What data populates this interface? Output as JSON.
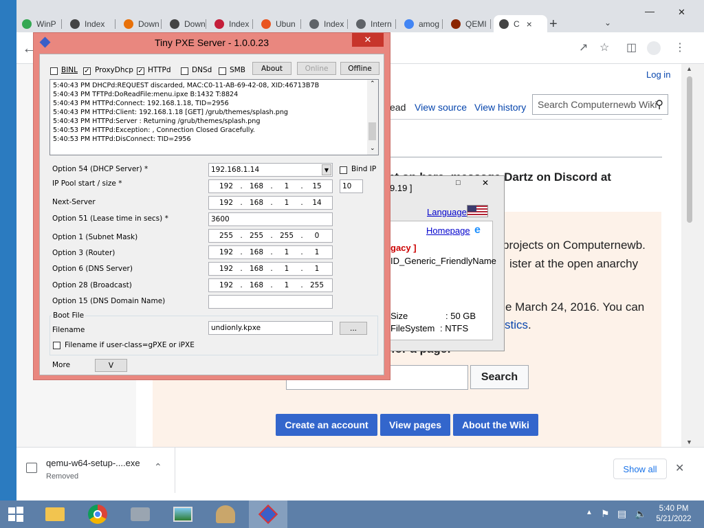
{
  "browser": {
    "tabs": [
      {
        "label": "WinP",
        "icon": "google-drive-icon",
        "color": "#34a853"
      },
      {
        "label": "Index",
        "icon": "archive-icon",
        "color": "#444444"
      },
      {
        "label": "Down",
        "icon": "diamond-icon",
        "color": "#e8710a"
      },
      {
        "label": "Down",
        "icon": "download-icon",
        "color": "#444444"
      },
      {
        "label": "Index",
        "icon": "arch-icon",
        "color": "#c41e3a"
      },
      {
        "label": "Ubun",
        "icon": "ubuntu-icon",
        "color": "#e95420"
      },
      {
        "label": "Index",
        "icon": "globe-icon",
        "color": "#5f6368"
      },
      {
        "label": "Intern",
        "icon": "globe-icon",
        "color": "#5f6368"
      },
      {
        "label": "amog",
        "icon": "google-icon",
        "color": "#4285f4"
      },
      {
        "label": "QEMI",
        "icon": "qemu-icon",
        "color": "#8b2500"
      },
      {
        "label": "C",
        "icon": "archive-icon",
        "color": "#444444"
      }
    ],
    "wiki": {
      "login": "Log in",
      "read_partial": "ead",
      "view_source": "View source",
      "view_history": "View history",
      "search_placeholder": "Search Computernewb Wiki",
      "notice": "nt on here, message Dartz on Discord at",
      "line1": "projects on Computernewb.",
      "line2": "ister at the open anarchy",
      "line3": "e March 24, 2016. You can",
      "stats_link": "stics",
      "stats_period": ".",
      "search_heading": "for a page:",
      "search_button": "Search",
      "buttons": [
        "Create an account",
        "View pages",
        "About the Wiki"
      ]
    },
    "download": {
      "filename": "qemu-w64-setup-....exe",
      "status": "Removed",
      "show_all": "Show all"
    }
  },
  "bgwin": {
    "version_partial": "9.19 ]",
    "language": "Language",
    "homepage": "Homepage",
    "legacy": "gacy ]",
    "friendly": "ID_Generic_FriendlyName",
    "size_label": "Size",
    "size_value": ": 50 GB",
    "fs_label": "FileSystem",
    "fs_value": ": NTFS"
  },
  "pxe": {
    "title": "Tiny PXE Server - 1.0.0.23",
    "checkboxes": [
      {
        "label": "BINL",
        "checked": false
      },
      {
        "label": "ProxyDhcp",
        "checked": true
      },
      {
        "label": "HTTPd",
        "checked": true
      },
      {
        "label": "DNSd",
        "checked": false
      },
      {
        "label": "SMB",
        "checked": false
      }
    ],
    "buttons": {
      "about": "About",
      "online": "Online",
      "offline": "Offline"
    },
    "log": [
      "5:40:43 PM DHCPd:REQUEST discarded, MAC:C0-11-AB-69-42-08, XID:46713B7B",
      "5:40:43 PM TFTPd:DoReadFile:menu.ipxe B:1432 T:8824",
      "5:40:43 PM HTTPd:Connect: 192.168.1.18, TID=2956",
      "5:40:43 PM HTTPd:Client: 192.168.1.18 [GET] /grub/themes/splash.png",
      "5:40:43 PM HTTPd:Server : Returning /grub/themes/splash.png",
      "5:40:53 PM HTTPd:Exception: , Connection Closed Gracefully.",
      "5:40:53 PM HTTPd:DisConnect: TID=2956"
    ],
    "labels": {
      "opt54": "Option 54 (DHCP Server) *",
      "pool": "IP Pool start / size *",
      "next": "Next-Server",
      "opt51": "Option 51 (Lease time in secs) *",
      "opt1": "Option 1  (Subnet Mask)",
      "opt3": "Option 3  (Router)",
      "opt6": "Option 6  (DNS Server)",
      "opt28": "Option 28 (Broadcast)",
      "opt15": "Option 15 (DNS Domain Name)",
      "bindip": "Bind IP",
      "bootfile": "Boot File",
      "filename": "Filename",
      "filename_if": "Filename if user-class=gPXE or iPXE",
      "more": "More"
    },
    "values": {
      "dhcp_server": "192.168.1.14",
      "pool_start": [
        "192",
        "168",
        "1",
        "15"
      ],
      "pool_size": "10",
      "next_server": [
        "192",
        "168",
        "1",
        "14"
      ],
      "lease": "3600",
      "subnet": [
        "255",
        "255",
        "255",
        "0"
      ],
      "router": [
        "192",
        "168",
        "1",
        "1"
      ],
      "dns": [
        "192",
        "168",
        "1",
        "1"
      ],
      "broadcast": [
        "192",
        "168",
        "1",
        "255"
      ],
      "domain": "",
      "filename": "undionly.kpxe",
      "browse": "...",
      "more_btn": "V"
    }
  },
  "taskbar": {
    "time": "5:40 PM",
    "date": "5/21/2022"
  }
}
